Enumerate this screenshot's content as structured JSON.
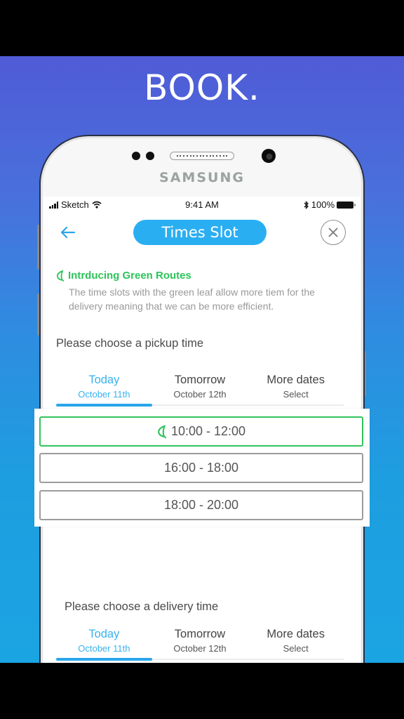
{
  "headline": "BOOK.",
  "device": {
    "brand": "SAMSUNG"
  },
  "status_bar": {
    "carrier": "Sketch",
    "time": "9:41 AM",
    "battery": "100%"
  },
  "nav": {
    "back_icon": "arrow-left-icon",
    "title": "Times Slot",
    "close_icon": "close-circle-icon"
  },
  "intro": {
    "icon": "leaf-icon",
    "title": "Intrducing Green Routes",
    "body": "The time slots with  the green leaf allow more tiem for the delivery meaning that we can be more efficient."
  },
  "pickup": {
    "label": "Please choose a pickup time",
    "tabs": [
      {
        "main": "Today",
        "sub": "October 11th",
        "active": true
      },
      {
        "main": "Tomorrow",
        "sub": "October 12th",
        "active": false
      },
      {
        "main": "More dates",
        "sub": "Select",
        "active": false
      }
    ],
    "slots": [
      {
        "time": "10:00 - 12:00",
        "green": true
      },
      {
        "time": "16:00 - 18:00",
        "green": false
      },
      {
        "time": "18:00 - 20:00",
        "green": false
      }
    ]
  },
  "delivery": {
    "label": "Please choose a delivery time",
    "tabs": [
      {
        "main": "Today",
        "sub": "October 11th",
        "active": true
      },
      {
        "main": "Tomorrow",
        "sub": "October 12th",
        "active": false
      },
      {
        "main": "More dates",
        "sub": "Select",
        "active": false
      }
    ]
  },
  "colors": {
    "accent_blue": "#2aaef2",
    "green": "#2bc45a",
    "background_top": "#4f5bd6",
    "background_bottom": "#1ba4e2"
  }
}
